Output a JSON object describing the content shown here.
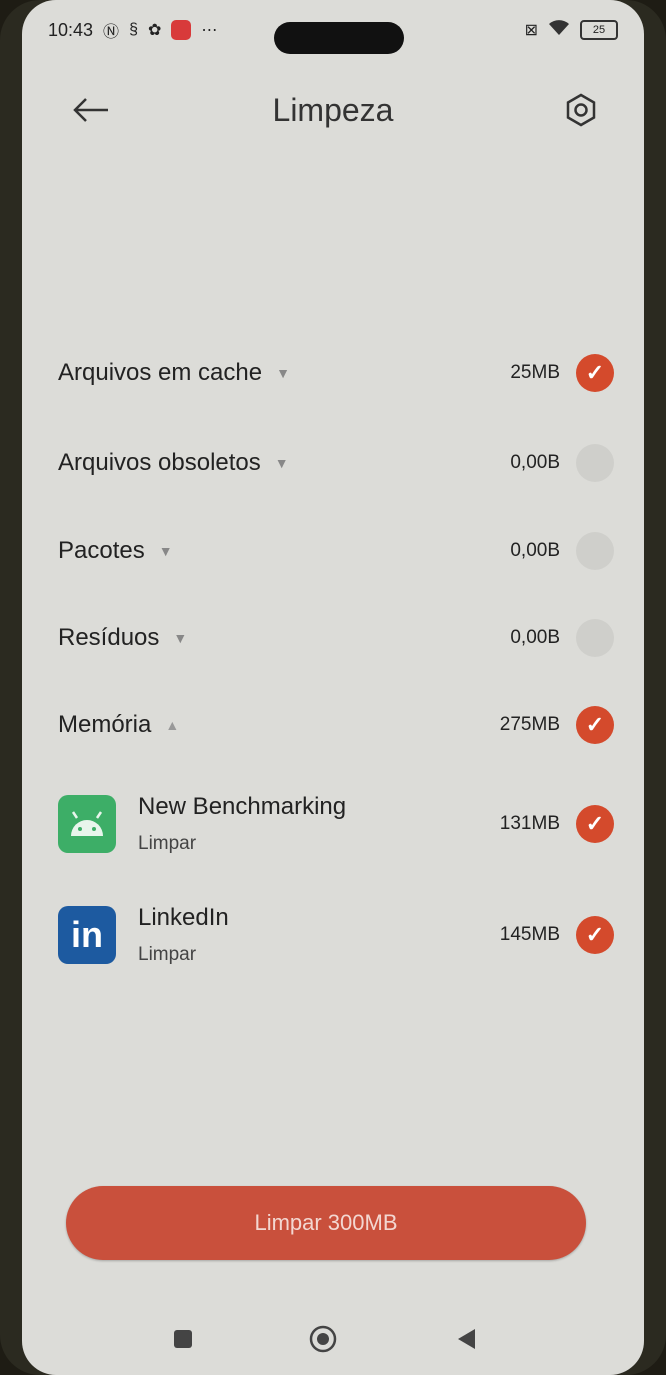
{
  "status_bar": {
    "time": "10:43",
    "battery": "25"
  },
  "header": {
    "title": "Limpeza"
  },
  "cleanup": {
    "items": [
      {
        "label": "Arquivos em cache",
        "size": "25MB",
        "checked": true
      },
      {
        "label": "Arquivos obsoletos",
        "size": "0,00B",
        "checked": false
      },
      {
        "label": "Pacotes",
        "size": "0,00B",
        "checked": false
      },
      {
        "label": "Resíduos",
        "size": "0,00B",
        "checked": false
      }
    ],
    "memory": {
      "label": "Memória",
      "size": "275MB",
      "checked": true
    }
  },
  "apps": [
    {
      "name": "New Benchmarking",
      "action": "Limpar",
      "size": "131MB",
      "checked": true,
      "icon": "android-icon"
    },
    {
      "name": "LinkedIn",
      "action": "Limpar",
      "size": "145MB",
      "checked": true,
      "icon": "linkedin-icon"
    }
  ],
  "footer": {
    "clean_button_label": "Limpar 300MB"
  },
  "colors": {
    "accent": "#d44a2c",
    "button": "#c9503c",
    "background": "#dcdcd8"
  }
}
